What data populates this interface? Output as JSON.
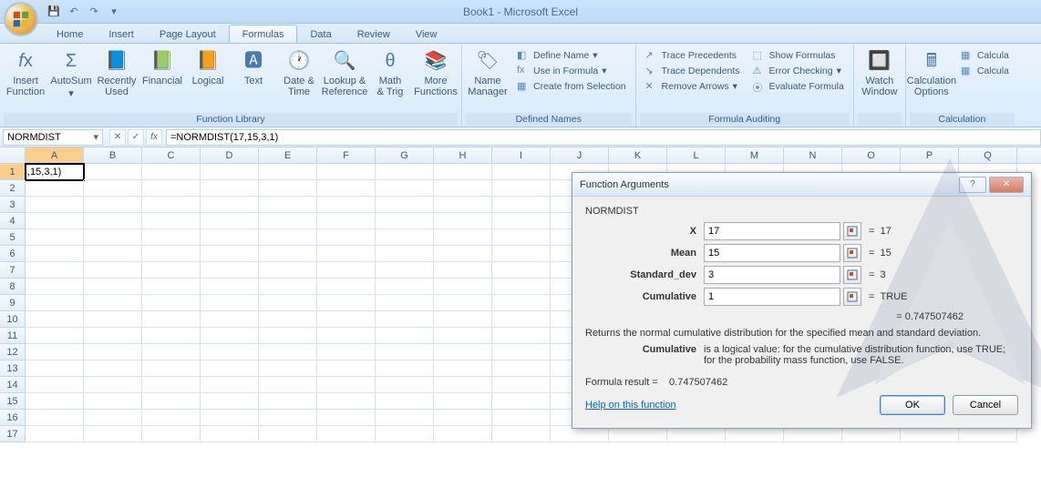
{
  "app": {
    "title": "Book1 - Microsoft Excel"
  },
  "tabs": {
    "home": "Home",
    "insert": "Insert",
    "page_layout": "Page Layout",
    "formulas": "Formulas",
    "data": "Data",
    "review": "Review",
    "view": "View"
  },
  "ribbon": {
    "insert_function": "Insert\nFunction",
    "autosum": "AutoSum",
    "recently_used": "Recently\nUsed",
    "financial": "Financial",
    "logical": "Logical",
    "text": "Text",
    "date_time": "Date &\nTime",
    "lookup_ref": "Lookup &\nReference",
    "math_trig": "Math\n& Trig",
    "more_funcs": "More\nFunctions",
    "group_func_library": "Function Library",
    "name_manager": "Name\nManager",
    "define_name": "Define Name",
    "use_in_formula": "Use in Formula",
    "create_from_selection": "Create from Selection",
    "group_defined_names": "Defined Names",
    "trace_precedents": "Trace Precedents",
    "trace_dependents": "Trace Dependents",
    "remove_arrows": "Remove Arrows",
    "show_formulas": "Show Formulas",
    "error_checking": "Error Checking",
    "evaluate_formula": "Evaluate Formula",
    "group_formula_auditing": "Formula Auditing",
    "watch_window": "Watch\nWindow",
    "calc_options": "Calculation\nOptions",
    "calculate": "Calcula",
    "calculate2": "Calcula",
    "group_calculation": "Calculation"
  },
  "formula_bar": {
    "name_box": "NORMDIST",
    "formula": "=NORMDIST(17,15,3,1)"
  },
  "grid": {
    "cols": [
      "A",
      "B",
      "C",
      "D",
      "E",
      "F",
      "G",
      "H",
      "I",
      "J",
      "K",
      "L",
      "M",
      "N",
      "O",
      "P",
      "Q"
    ],
    "row_count": 17,
    "active_cell_display": ",15,3,1)"
  },
  "dialog": {
    "title": "Function Arguments",
    "func_name": "NORMDIST",
    "args": [
      {
        "label": "X",
        "value": "17",
        "eval": "17",
        "bold": true
      },
      {
        "label": "Mean",
        "value": "15",
        "eval": "15",
        "bold": true
      },
      {
        "label": "Standard_dev",
        "value": "3",
        "eval": "3",
        "bold": true
      },
      {
        "label": "Cumulative",
        "value": "1",
        "eval": "TRUE",
        "bold": true
      }
    ],
    "result_eq": "=  0.747507462",
    "description": "Returns the normal cumulative distribution for the specified mean and standard deviation.",
    "arg_desc_label": "Cumulative",
    "arg_desc_text": "is a logical value: for the cumulative distribution function, use TRUE; for the probability mass function, use FALSE.",
    "formula_result_label": "Formula result =",
    "formula_result_value": "0.747507462",
    "help_link": "Help on this function",
    "ok": "OK",
    "cancel": "Cancel"
  }
}
